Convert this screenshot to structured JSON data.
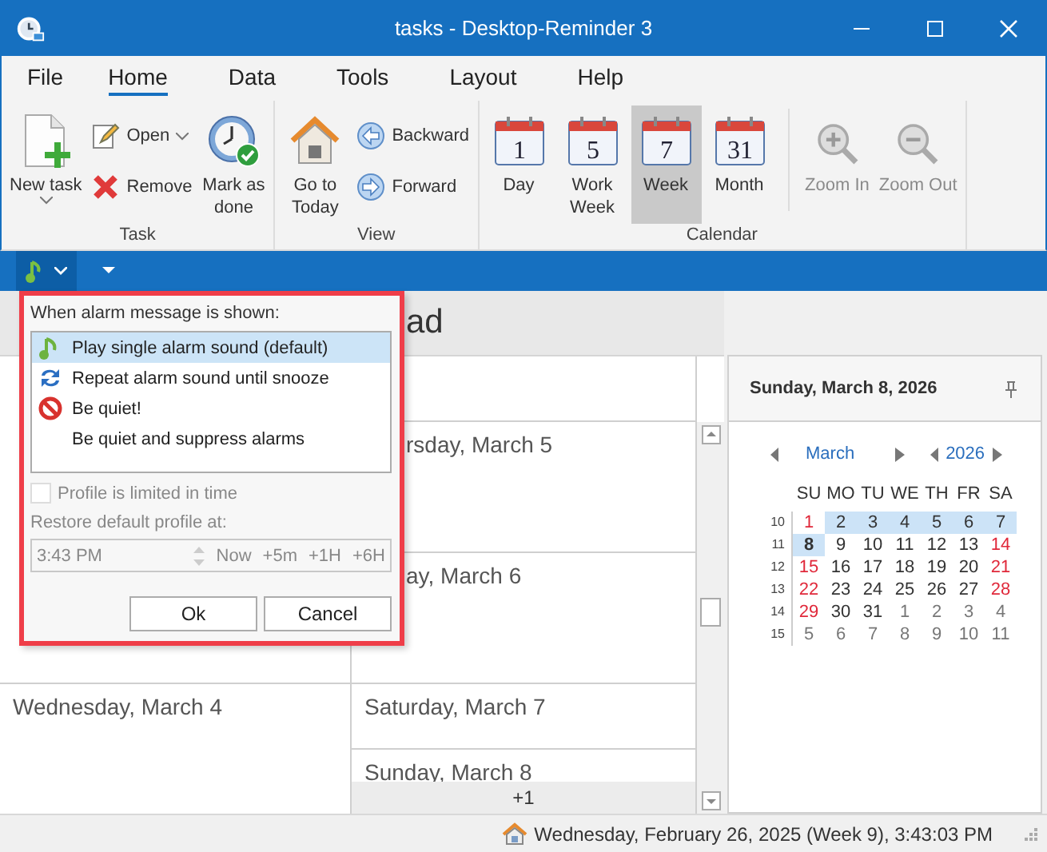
{
  "window": {
    "title": "tasks - Desktop-Reminder 3"
  },
  "menu_tabs": [
    {
      "label": "File",
      "selected": false
    },
    {
      "label": "Home",
      "selected": true
    },
    {
      "label": "Data",
      "selected": false
    },
    {
      "label": "Tools",
      "selected": false
    },
    {
      "label": "Layout",
      "selected": false
    },
    {
      "label": "Help",
      "selected": false
    }
  ],
  "ribbon_groups": [
    {
      "label": "Task",
      "items": [
        {
          "kind": "large",
          "label": "New task",
          "dropdown": true
        },
        {
          "kind": "stack",
          "items": [
            {
              "label": "Open",
              "dropdown": true
            },
            {
              "label": "Remove"
            }
          ]
        },
        {
          "kind": "large",
          "label": "Mark as\ndone"
        }
      ]
    },
    {
      "label": "View",
      "items": [
        {
          "kind": "large",
          "label": "Go to\nToday"
        },
        {
          "kind": "stack",
          "items": [
            {
              "label": "Backward"
            },
            {
              "label": "Forward"
            }
          ]
        }
      ]
    },
    {
      "label": "Calendar",
      "items": [
        {
          "kind": "calendar",
          "label": "Day",
          "icon_text": "1",
          "selected": false
        },
        {
          "kind": "calendar",
          "label": "Work\nWeek",
          "icon_text": "5",
          "selected": false
        },
        {
          "kind": "calendar",
          "label": "Week",
          "icon_text": "7",
          "selected": true
        },
        {
          "kind": "calendar",
          "label": "Month",
          "icon_text": "31",
          "selected": false
        },
        {
          "kind": "separator"
        },
        {
          "kind": "large",
          "label": "Zoom In",
          "disabled": true
        },
        {
          "kind": "large",
          "label": "Zoom Out",
          "disabled": true
        }
      ]
    }
  ],
  "day_view": {
    "title": "ad",
    "left_days": [
      "Wednesday, March 4"
    ],
    "right_days": [
      "rsday, March 5",
      "ay, March 6",
      "Saturday, March 7",
      "Sunday, March 8"
    ],
    "more": "+1"
  },
  "alarm_popup": {
    "prompt": "When alarm message is shown:",
    "options": [
      {
        "label": "Play single alarm sound (default)",
        "selected": true
      },
      {
        "label": "Repeat alarm sound until snooze",
        "selected": false
      },
      {
        "label": "Be quiet!",
        "selected": false
      },
      {
        "label": "Be quiet and suppress alarms",
        "selected": false
      }
    ],
    "limit": {
      "label": "Profile is limited in time",
      "checked": false,
      "disabled": true
    },
    "restore_label": "Restore default profile at:",
    "time": "3:43 PM",
    "quick_buttons": [
      "Now",
      "+5m",
      "+1H",
      "+6H"
    ],
    "buttons": [
      "Ok",
      "Cancel"
    ]
  },
  "date_panel": {
    "title": "Sunday, March 8, 2026",
    "month": "March",
    "year": "2026",
    "weekdays": [
      "SU",
      "MO",
      "TU",
      "WE",
      "TH",
      "FR",
      "SA"
    ],
    "weeks": [
      {
        "number": "10",
        "days": [
          {
            "day": "1",
            "kind": "weekend",
            "highlighted": false,
            "selected": false
          },
          {
            "day": "2",
            "kind": "weekday",
            "highlighted": true,
            "selected": false
          },
          {
            "day": "3",
            "kind": "weekday",
            "highlighted": true,
            "selected": false
          },
          {
            "day": "4",
            "kind": "weekday",
            "highlighted": true,
            "selected": false
          },
          {
            "day": "5",
            "kind": "weekday",
            "highlighted": true,
            "selected": false
          },
          {
            "day": "6",
            "kind": "weekday",
            "highlighted": true,
            "selected": false
          },
          {
            "day": "7",
            "kind": "weekday",
            "highlighted": true,
            "selected": false
          }
        ]
      },
      {
        "number": "11",
        "days": [
          {
            "day": "8",
            "kind": "weekday",
            "highlighted": true,
            "selected": true
          },
          {
            "day": "9",
            "kind": "weekday",
            "highlighted": false,
            "selected": false
          },
          {
            "day": "10",
            "kind": "weekday",
            "highlighted": false,
            "selected": false
          },
          {
            "day": "11",
            "kind": "weekday",
            "highlighted": false,
            "selected": false
          },
          {
            "day": "12",
            "kind": "weekday",
            "highlighted": false,
            "selected": false
          },
          {
            "day": "13",
            "kind": "weekday",
            "highlighted": false,
            "selected": false
          },
          {
            "day": "14",
            "kind": "weekend",
            "highlighted": false,
            "selected": false
          }
        ]
      },
      {
        "number": "12",
        "days": [
          {
            "day": "15",
            "kind": "weekend",
            "highlighted": false,
            "selected": false
          },
          {
            "day": "16",
            "kind": "weekday",
            "highlighted": false,
            "selected": false
          },
          {
            "day": "17",
            "kind": "weekday",
            "highlighted": false,
            "selected": false
          },
          {
            "day": "18",
            "kind": "weekday",
            "highlighted": false,
            "selected": false
          },
          {
            "day": "19",
            "kind": "weekday",
            "highlighted": false,
            "selected": false
          },
          {
            "day": "20",
            "kind": "weekday",
            "highlighted": false,
            "selected": false
          },
          {
            "day": "21",
            "kind": "weekend",
            "highlighted": false,
            "selected": false
          }
        ]
      },
      {
        "number": "13",
        "days": [
          {
            "day": "22",
            "kind": "weekend",
            "highlighted": false,
            "selected": false
          },
          {
            "day": "23",
            "kind": "weekday",
            "highlighted": false,
            "selected": false
          },
          {
            "day": "24",
            "kind": "weekday",
            "highlighted": false,
            "selected": false
          },
          {
            "day": "25",
            "kind": "weekday",
            "highlighted": false,
            "selected": false
          },
          {
            "day": "26",
            "kind": "weekday",
            "highlighted": false,
            "selected": false
          },
          {
            "day": "27",
            "kind": "weekday",
            "highlighted": false,
            "selected": false
          },
          {
            "day": "28",
            "kind": "weekend",
            "highlighted": false,
            "selected": false
          }
        ]
      },
      {
        "number": "14",
        "days": [
          {
            "day": "29",
            "kind": "weekend",
            "highlighted": false,
            "selected": false
          },
          {
            "day": "30",
            "kind": "weekday",
            "highlighted": false,
            "selected": false
          },
          {
            "day": "31",
            "kind": "weekday",
            "highlighted": false,
            "selected": false
          },
          {
            "day": "1",
            "kind": "other",
            "highlighted": false,
            "selected": false
          },
          {
            "day": "2",
            "kind": "other",
            "highlighted": false,
            "selected": false
          },
          {
            "day": "3",
            "kind": "other",
            "highlighted": false,
            "selected": false
          },
          {
            "day": "4",
            "kind": "other",
            "highlighted": false,
            "selected": false
          }
        ]
      },
      {
        "number": "15",
        "days": [
          {
            "day": "5",
            "kind": "other",
            "highlighted": false,
            "selected": false
          },
          {
            "day": "6",
            "kind": "other",
            "highlighted": false,
            "selected": false
          },
          {
            "day": "7",
            "kind": "other",
            "highlighted": false,
            "selected": false
          },
          {
            "day": "8",
            "kind": "other",
            "highlighted": false,
            "selected": false
          },
          {
            "day": "9",
            "kind": "other",
            "highlighted": false,
            "selected": false
          },
          {
            "day": "10",
            "kind": "other",
            "highlighted": false,
            "selected": false
          },
          {
            "day": "11",
            "kind": "other",
            "highlighted": false,
            "selected": false
          }
        ]
      }
    ]
  },
  "status_bar": {
    "text": "Wednesday, February 26, 2025 (Week 9), 3:43:03 PM"
  }
}
